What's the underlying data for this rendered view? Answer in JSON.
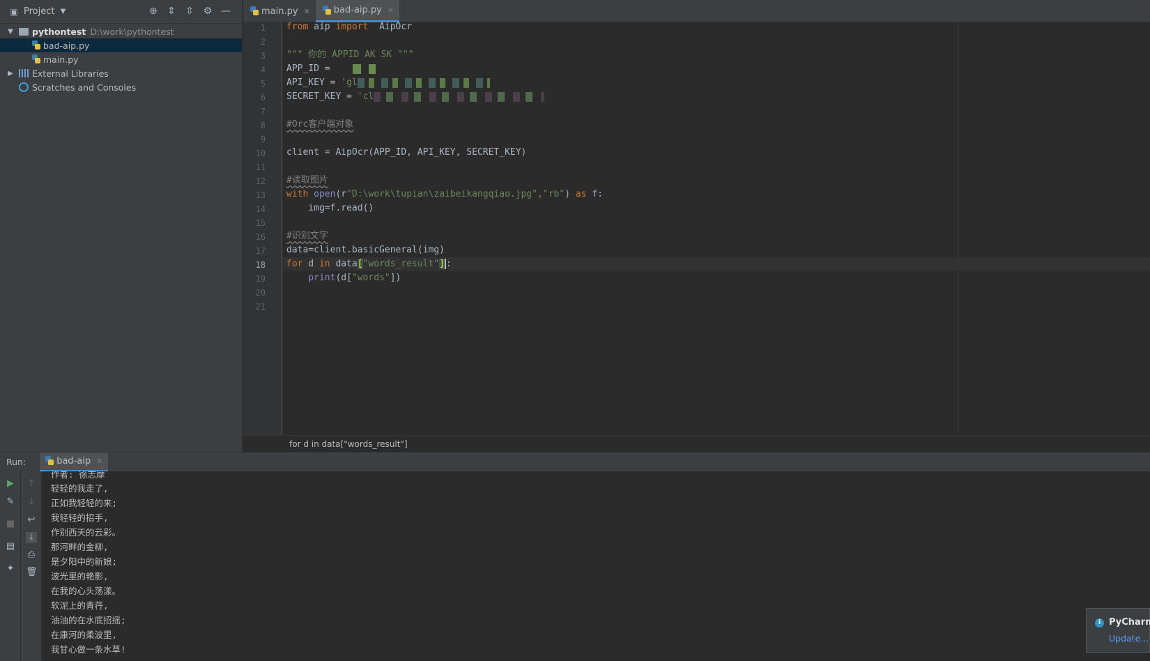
{
  "project_panel": {
    "title": "Project",
    "tree": [
      {
        "label": "pythontest",
        "path": "D:\\work\\pythontest"
      },
      {
        "label": "bad-aip.py"
      },
      {
        "label": "main.py"
      },
      {
        "label": "External Libraries"
      },
      {
        "label": "Scratches and Consoles"
      }
    ]
  },
  "editor": {
    "tabs": [
      {
        "label": "main.py",
        "active": false
      },
      {
        "label": "bad-aip.py",
        "active": true
      }
    ],
    "current_line": "18",
    "line_numbers": [
      "1",
      "2",
      "3",
      "4",
      "5",
      "6",
      "7",
      "8",
      "9",
      "10",
      "11",
      "12",
      "13",
      "14",
      "15",
      "16",
      "17",
      "18",
      "19",
      "20",
      "21"
    ],
    "code": {
      "l1_a": "from",
      "l1_b": " aip ",
      "l1_c": "import",
      "l1_d": "  AipOcr",
      "l3": "\"\"\" 你的 APPID AK SK \"\"\"",
      "l4": "APP_ID = ",
      "l5_a": "API_KEY = ",
      "l5_b": "'gl",
      "l6_a": "SECRET_KEY = ",
      "l6_b": "'cl",
      "l8": "#Orc客户端对象",
      "l10": "client = AipOcr(APP_ID, API_KEY, SECRET_KEY)",
      "l12": "#读取图片",
      "l13_a": "with",
      "l13_b": "open",
      "l13_c": "(r",
      "l13_d": "\"D:\\work\\tupian\\zaibeikangqiao.jpg\"",
      "l13_e": ",",
      "l13_f": "\"rb\"",
      "l13_g": ") ",
      "l13_h": "as",
      "l13_i": " f:",
      "l14": "    img=f.read()",
      "l16": "#识别文字",
      "l17": "data=client.basicGeneral(img)",
      "l18_a": "for",
      "l18_b": " d ",
      "l18_c": "in",
      "l18_d": " data",
      "l18_e": "[",
      "l18_f": "\"words_result\"",
      "l18_g": "]",
      "l18_h": ":",
      "l19_a": "    ",
      "l19_b": "print",
      "l19_c": "(d[",
      "l19_d": "\"words\"",
      "l19_e": "])"
    },
    "breadcrumb": "for d in data[\"words_result\"]"
  },
  "run": {
    "label": "Run:",
    "tab": "bad-aip",
    "output": [
      "作者: 徐志摩",
      "轻轻的我走了,",
      "正如我轻轻的来;",
      "我轻轻的招手,",
      "作别西天的云彩。",
      "那河畔的金柳,",
      "是夕阳中的新娘;",
      "波光里的艳影,",
      "在我的心头荡漾。",
      "软泥上的青荇,",
      "油油的在水底招摇;",
      "在康河的柔波里,",
      "我甘心做一条水草!"
    ]
  },
  "notification": {
    "title": "PyCharm",
    "link": "Update..."
  },
  "colors": {
    "keyword": "#cc7832",
    "string": "#6a8759",
    "comment": "#808080",
    "accent": "#4a88c7"
  }
}
